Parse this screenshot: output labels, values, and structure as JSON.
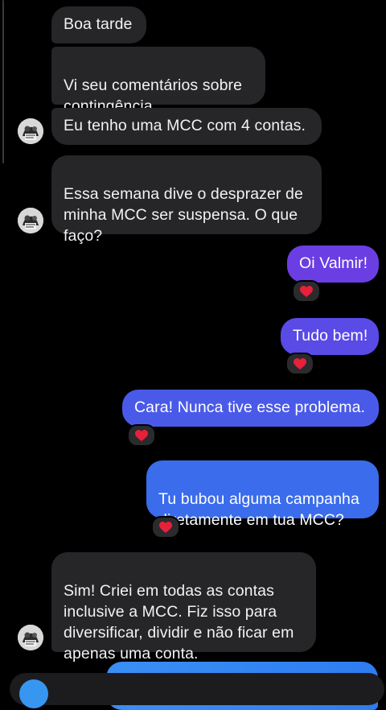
{
  "messages": [
    {
      "id": "m1",
      "side": "in",
      "text": "Boa tarde"
    },
    {
      "id": "m2",
      "side": "in",
      "text": "Vi seu comentários sobre\ncontingência."
    },
    {
      "id": "m3",
      "side": "in",
      "text": "Eu tenho uma MCC com 4 contas."
    },
    {
      "id": "m4",
      "side": "in",
      "text": "Essa semana dive o desprazer de\nminha MCC ser suspensa. O que\nfaço?"
    },
    {
      "id": "m5",
      "side": "out",
      "text": "Oi Valmir!",
      "reaction": "❤️"
    },
    {
      "id": "m6",
      "side": "out",
      "text": "Tudo bem!",
      "reaction": "❤️"
    },
    {
      "id": "m7",
      "side": "out",
      "text": "Cara! Nunca tive esse problema.",
      "reaction": "❤️"
    },
    {
      "id": "m8",
      "side": "out",
      "text": "Tu bubou alguma campanha\ndiretamente em tua MCC?",
      "reaction": "❤️"
    },
    {
      "id": "m9",
      "side": "in",
      "text": "Sim! Criei em todas as contas\ninclusive a MCC. Fiz isso para\ndiversificar, dividir e não ficar em\napenas uma conta."
    }
  ],
  "icons": {
    "avatar": "contact-avatar",
    "reaction": "red-heart-icon"
  },
  "colors": {
    "background": "#000000",
    "incoming_bubble": "#262629",
    "outgoing_purple": "#6b3ee3",
    "outgoing_blue": "#3a6cec",
    "reaction_heart": "#e8203a"
  }
}
